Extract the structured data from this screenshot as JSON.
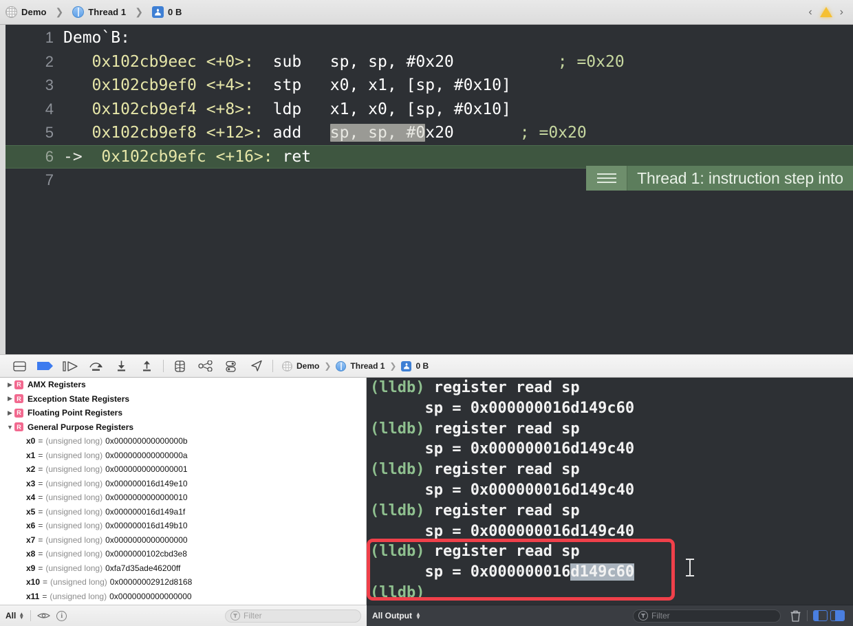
{
  "jumpbar": {
    "project": "Demo",
    "thread": "Thread 1",
    "frame": "0 B",
    "prev_label": "‹",
    "next_label": "›"
  },
  "editor": {
    "lines": [
      {
        "num": "1",
        "arrow": "",
        "addr": "",
        "label": "Demo`B:",
        "mnem": "",
        "ops": "",
        "comment": ""
      },
      {
        "num": "2",
        "arrow": "",
        "addr": "0x102cb9eec <+0>:",
        "label": "",
        "mnem": "sub",
        "ops": "sp, sp, #0x20",
        "comment": "; =0x20"
      },
      {
        "num": "3",
        "arrow": "",
        "addr": "0x102cb9ef0 <+4>:",
        "label": "",
        "mnem": "stp",
        "ops": "x0, x1, [sp, #0x10]",
        "comment": ""
      },
      {
        "num": "4",
        "arrow": "",
        "addr": "0x102cb9ef4 <+8>:",
        "label": "",
        "mnem": "ldp",
        "ops": "x1, x0, [sp, #0x10]",
        "comment": ""
      },
      {
        "num": "5",
        "arrow": "",
        "addr": "0x102cb9ef8 <+12>:",
        "label": "",
        "mnem": "add",
        "ops_selected": "sp, sp, #0",
        "ops_rest": "x20",
        "ops": "sp, sp, #0x20",
        "comment": "; =0x20"
      },
      {
        "num": "6",
        "arrow": "->",
        "addr": "0x102cb9efc <+16>:",
        "label": "",
        "mnem": "ret",
        "ops": "",
        "comment": ""
      },
      {
        "num": "7",
        "arrow": "",
        "addr": "",
        "label": "",
        "mnem": "",
        "ops": "",
        "comment": ""
      }
    ],
    "bubble_text": "Thread 1: instruction step into"
  },
  "debug_toolbar": {
    "buttons": [
      {
        "name": "hide-debug-area",
        "icon": "panel-icon"
      },
      {
        "name": "deactivate-breakpoints",
        "icon": "breakpoint-icon"
      },
      {
        "name": "continue-program",
        "icon": "continue-icon"
      },
      {
        "name": "step-over",
        "icon": "step-over-icon"
      },
      {
        "name": "step-into",
        "icon": "step-into-icon"
      },
      {
        "name": "step-out",
        "icon": "step-out-icon"
      },
      {
        "name": "debug-view-hierarchy",
        "icon": "view-hierarchy-icon"
      },
      {
        "name": "debug-memory-graph",
        "icon": "memory-graph-icon"
      },
      {
        "name": "environment-overrides",
        "icon": "environment-icon"
      },
      {
        "name": "simulate-location",
        "icon": "location-icon"
      }
    ],
    "crumbs": {
      "project": "Demo",
      "thread": "Thread 1",
      "frame": "0 B"
    }
  },
  "variables": {
    "groups": [
      {
        "label": "AMX Registers",
        "expanded": false,
        "badge": "R"
      },
      {
        "label": "Exception State Registers",
        "expanded": false,
        "badge": "R"
      },
      {
        "label": "Floating Point Registers",
        "expanded": false,
        "badge": "R"
      },
      {
        "label": "General Purpose Registers",
        "expanded": true,
        "badge": "R"
      }
    ],
    "registers": [
      {
        "name": "x0",
        "type": "(unsigned long)",
        "value": "0x000000000000000b"
      },
      {
        "name": "x1",
        "type": "(unsigned long)",
        "value": "0x000000000000000a"
      },
      {
        "name": "x2",
        "type": "(unsigned long)",
        "value": "0x0000000000000001"
      },
      {
        "name": "x3",
        "type": "(unsigned long)",
        "value": "0x000000016d149e10"
      },
      {
        "name": "x4",
        "type": "(unsigned long)",
        "value": "0x0000000000000010"
      },
      {
        "name": "x5",
        "type": "(unsigned long)",
        "value": "0x000000016d149a1f"
      },
      {
        "name": "x6",
        "type": "(unsigned long)",
        "value": "0x000000016d149b10"
      },
      {
        "name": "x7",
        "type": "(unsigned long)",
        "value": "0x0000000000000000"
      },
      {
        "name": "x8",
        "type": "(unsigned long)",
        "value": "0x0000000102cbd3e8"
      },
      {
        "name": "x9",
        "type": "(unsigned long)",
        "value": "0xfa7d35ade46200ff"
      },
      {
        "name": "x10",
        "type": "(unsigned long)",
        "value": "0x00000002912d8168"
      },
      {
        "name": "x11",
        "type": "(unsigned long)",
        "value": "0x0000000000000000"
      }
    ]
  },
  "console": {
    "lines": [
      {
        "type": "command",
        "prompt": "(lldb)",
        "text": " register read sp"
      },
      {
        "type": "result",
        "text": "      sp = 0x000000016d149c60"
      },
      {
        "type": "command",
        "prompt": "(lldb)",
        "text": " register read sp"
      },
      {
        "type": "result",
        "text": "      sp = 0x000000016d149c40"
      },
      {
        "type": "command",
        "prompt": "(lldb)",
        "text": " register read sp"
      },
      {
        "type": "result",
        "text": "      sp = 0x000000016d149c40"
      },
      {
        "type": "command",
        "prompt": "(lldb)",
        "text": " register read sp"
      },
      {
        "type": "result",
        "text": "      sp = 0x000000016d149c40"
      },
      {
        "type": "command",
        "prompt": "(lldb)",
        "text": " register read sp"
      },
      {
        "type": "result-selected",
        "text": "      sp = 0x000000016",
        "selected": "d149c60"
      },
      {
        "type": "command",
        "prompt": "(lldb)",
        "text": ""
      }
    ],
    "annotation_color": "#f0404a"
  },
  "status_left": {
    "scope": "All",
    "filter_placeholder": "Filter"
  },
  "status_right": {
    "scope": "All Output",
    "filter_placeholder": "Filter"
  },
  "colors": {
    "editor_bg": "#2d3034",
    "current_line": "#3e5640",
    "bubble": "#5c7d5c",
    "prompt_green": "#8fc08f",
    "address_yellow": "#e6e6a8",
    "annotation_red": "#f0404a",
    "badge_pink": "#f2698f",
    "accent_blue": "#4a7fe0"
  }
}
